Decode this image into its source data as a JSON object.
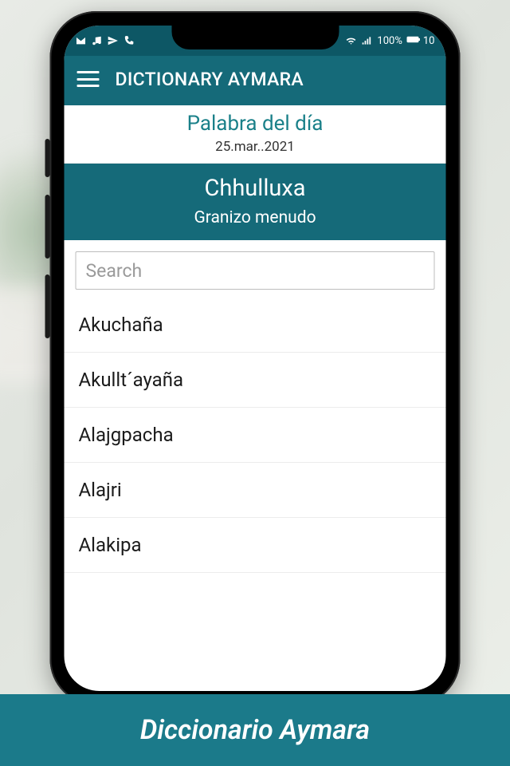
{
  "status": {
    "battery_pct": "100%",
    "battery_extra": "10"
  },
  "appbar": {
    "title": "DICTIONARY AYMARA"
  },
  "wod": {
    "label": "Palabra del día",
    "date": "25.mar..2021",
    "word": "Chhulluxa",
    "definition": "Granizo menudo"
  },
  "search": {
    "placeholder": "Search",
    "value": ""
  },
  "words": [
    "Akuchaña",
    "Akullt´ayaña",
    "Alajgpacha",
    "Alajri",
    "Alakipa"
  ],
  "banner": "Diccionario Aymara",
  "colors": {
    "teal": "#156a79",
    "teal_dark": "#0d5765",
    "accent": "#1a8089"
  }
}
